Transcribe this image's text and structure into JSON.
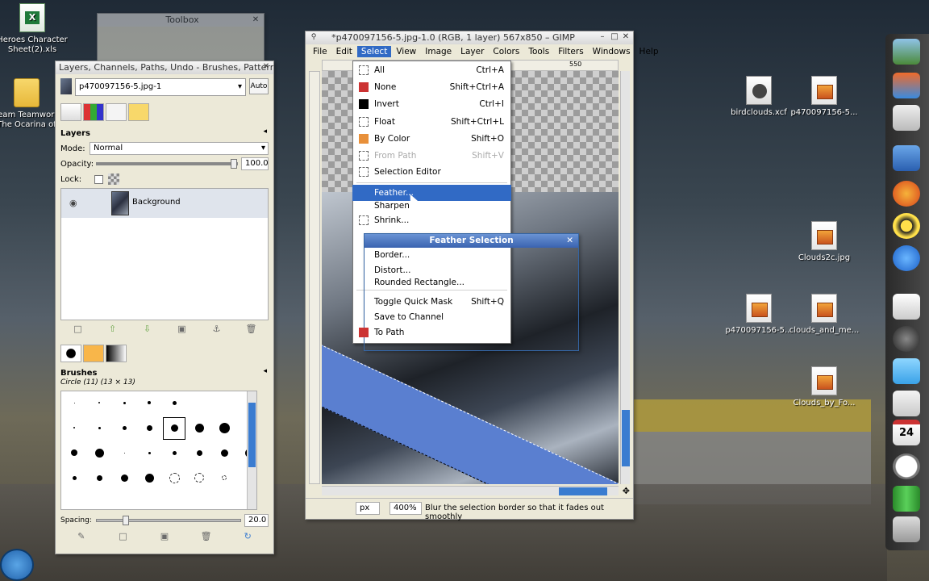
{
  "desktop": {
    "icons_left": [
      {
        "name": "excel-file-icon",
        "label": "Heroes Character Sheet(2).xls",
        "type": "xls"
      },
      {
        "name": "folder-icon",
        "label": "Team Teamwork The Ocarina of",
        "type": "folder"
      }
    ],
    "icons_right": [
      {
        "label": "birdclouds.xcf",
        "type": "xcf"
      },
      {
        "label": "p470097156-5...",
        "type": "img"
      },
      {
        "label": "Clouds2c.jpg",
        "type": "img"
      },
      {
        "label": "p470097156-5...",
        "type": "img"
      },
      {
        "label": "clouds_and_me...",
        "type": "img"
      },
      {
        "label": "Clouds_by_Fo...",
        "type": "img"
      }
    ]
  },
  "toolbox": {
    "title": "Toolbox"
  },
  "layers_dock": {
    "title": "Layers, Channels, Paths, Undo - Brushes, Pattern...",
    "image_select": "p470097156-5.jpg-1",
    "auto_label": "Auto",
    "layers_header": "Layers",
    "mode_label": "Mode:",
    "mode_value": "Normal",
    "opacity_label": "Opacity:",
    "opacity_value": "100.0",
    "opacity_level": 1.0,
    "lock_label": "Lock:",
    "layer_name": "Background",
    "brushes_header": "Brushes",
    "brush_selected": "Circle (11) (13 × 13)",
    "spacing_label": "Spacing:",
    "spacing_value": "20.0",
    "spacing_level": 0.2
  },
  "image_window": {
    "title": "*p470097156-5.jpg-1.0 (RGB, 1 layer) 567x850 – GIMP",
    "menus": [
      "File",
      "Edit",
      "Select",
      "View",
      "Image",
      "Layer",
      "Colors",
      "Tools",
      "Filters",
      "Windows",
      "Help"
    ],
    "active_menu": "Select",
    "ruler_mark": "550",
    "unit": "px",
    "zoom": "400%",
    "status_text": "Blur the selection border so that it fades out smoothly"
  },
  "select_menu": {
    "items": [
      {
        "label": "All",
        "accel": "Ctrl+A",
        "icon": "select-all-icon"
      },
      {
        "label": "None",
        "accel": "Shift+Ctrl+A",
        "icon": "select-none-icon"
      },
      {
        "label": "Invert",
        "accel": "Ctrl+I",
        "icon": "invert-icon"
      },
      {
        "label": "Float",
        "accel": "Shift+Ctrl+L",
        "icon": "float-icon"
      },
      {
        "label": "By Color",
        "accel": "Shift+O",
        "icon": "by-color-icon"
      },
      {
        "label": "From Path",
        "accel": "Shift+V",
        "icon": "from-path-icon",
        "disabled": true
      },
      {
        "label": "Selection Editor",
        "accel": "",
        "icon": "selection-editor-icon"
      },
      {
        "label": "Feather...",
        "accel": "",
        "icon": "",
        "highlighted": true
      },
      {
        "label": "Sharpen",
        "accel": "",
        "icon": ""
      },
      {
        "label": "Shrink...",
        "accel": "",
        "icon": "shrink-icon"
      },
      {
        "label": "Border...",
        "accel": "",
        "icon": ""
      },
      {
        "label": "Distort...",
        "accel": "",
        "icon": ""
      },
      {
        "label": "Rounded Rectangle...",
        "accel": "",
        "icon": ""
      },
      {
        "label": "Toggle Quick Mask",
        "accel": "Shift+Q",
        "icon": ""
      },
      {
        "label": "Save to Channel",
        "accel": "",
        "icon": ""
      },
      {
        "label": "To Path",
        "accel": "",
        "icon": "to-path-icon"
      }
    ]
  },
  "feather_dialog": {
    "title": "Feather Selection"
  },
  "colors": {
    "accent": "#316ac5",
    "dialog_title": "#3a63b0",
    "selection_blue": "#5a7fd0"
  }
}
